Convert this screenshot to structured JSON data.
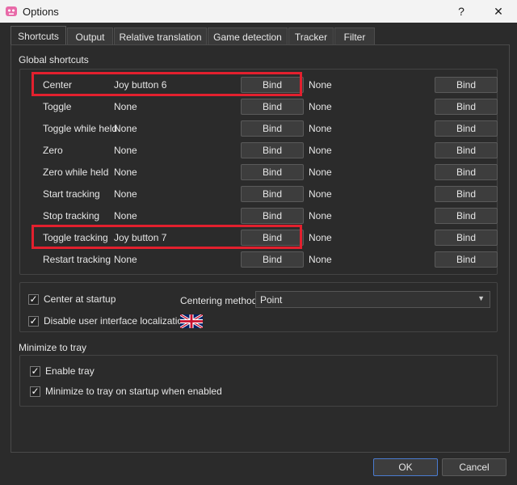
{
  "window": {
    "title": "Options",
    "help": "?",
    "close": "✕"
  },
  "tabs": [
    {
      "label": "Shortcuts"
    },
    {
      "label": "Output"
    },
    {
      "label": "Relative translation"
    },
    {
      "label": "Game detection"
    },
    {
      "label": "Tracker"
    },
    {
      "label": "Filter"
    }
  ],
  "global_shortcuts": {
    "label": "Global shortcuts",
    "rows": [
      {
        "name": "Center",
        "key1": "Joy button 6",
        "bind1": "Bind",
        "key2": "None",
        "bind2": "Bind"
      },
      {
        "name": "Toggle",
        "key1": "None",
        "bind1": "Bind",
        "key2": "None",
        "bind2": "Bind"
      },
      {
        "name": "Toggle while held",
        "key1": "None",
        "bind1": "Bind",
        "key2": "None",
        "bind2": "Bind"
      },
      {
        "name": "Zero",
        "key1": "None",
        "bind1": "Bind",
        "key2": "None",
        "bind2": "Bind"
      },
      {
        "name": "Zero while held",
        "key1": "None",
        "bind1": "Bind",
        "key2": "None",
        "bind2": "Bind"
      },
      {
        "name": "Start tracking",
        "key1": "None",
        "bind1": "Bind",
        "key2": "None",
        "bind2": "Bind"
      },
      {
        "name": "Stop tracking",
        "key1": "None",
        "bind1": "Bind",
        "key2": "None",
        "bind2": "Bind"
      },
      {
        "name": "Toggle tracking",
        "key1": "Joy button 7",
        "bind1": "Bind",
        "key2": "None",
        "bind2": "Bind"
      },
      {
        "name": "Restart tracking",
        "key1": "None",
        "bind1": "Bind",
        "key2": "None",
        "bind2": "Bind"
      }
    ]
  },
  "general": {
    "center_at_startup": {
      "label": "Center at startup",
      "checked": "✓"
    },
    "disable_localization": {
      "label": "Disable user interface localization",
      "checked": "✓"
    },
    "centering_method": {
      "label": "Centering method",
      "value": "Point"
    },
    "flag_icon": "uk-flag-icon"
  },
  "tray": {
    "label": "Minimize to tray",
    "enable_tray": {
      "label": "Enable tray",
      "checked": "✓"
    },
    "minimize_on_startup": {
      "label": "Minimize to tray on startup when enabled",
      "checked": "✓"
    }
  },
  "buttons": {
    "ok": "OK",
    "cancel": "Cancel"
  },
  "colors": {
    "highlight": "#e3202e",
    "default_button_border": "#4a7bd0"
  }
}
